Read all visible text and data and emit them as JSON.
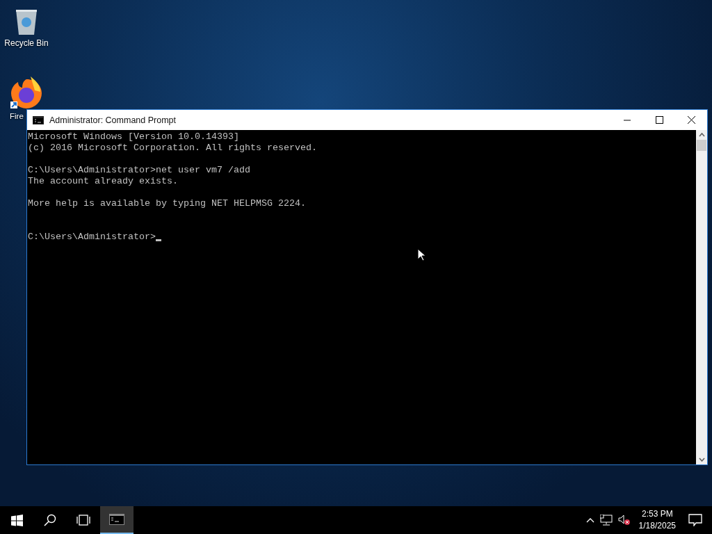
{
  "desktop_icons": [
    {
      "label": "Recycle Bin",
      "kind": "recycle"
    },
    {
      "label": "Fire",
      "kind": "browser"
    }
  ],
  "window": {
    "title": "Administrator: Command Prompt",
    "active": true
  },
  "console": {
    "blocks": [
      [
        "Microsoft Windows [Version 10.0.14393]",
        "(c) 2016 Microsoft Corporation. All rights reserved."
      ],
      [
        "C:\\Users\\Administrator>net user vm7 /add",
        "The account already exists."
      ],
      [
        "More help is available by typing NET HELPMSG 2224."
      ]
    ],
    "prompt": "C:\\Users\\Administrator>",
    "cursor": true
  },
  "taskbar": {
    "apps": [
      {
        "kind": "cmd",
        "selected": true
      }
    ],
    "tray": {
      "volume_muted": true,
      "time": "2:53 PM",
      "date": "1/18/2025"
    }
  }
}
